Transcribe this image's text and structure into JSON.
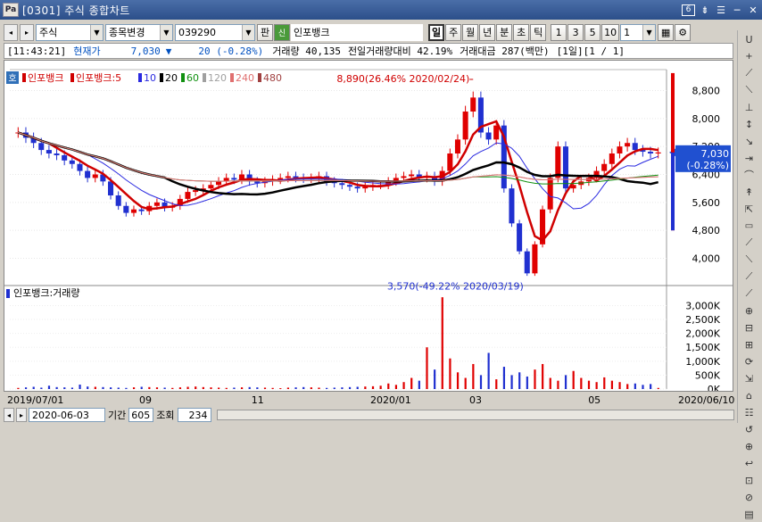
{
  "window": {
    "title": "[0301] 주식 종합차트",
    "badge_num": "6",
    "pin": "⇟",
    "menu": "☰",
    "minimize": "─",
    "close": "✕"
  },
  "toolbar": {
    "nav_prev": "◂",
    "nav_next": "▸",
    "market": "주식",
    "mode": "종목변경",
    "code": "039290",
    "search": "판",
    "stock_tag": "신",
    "stock_name": "인포뱅크",
    "periods": [
      "일",
      "주",
      "월",
      "년",
      "분",
      "초",
      "틱"
    ],
    "intervals": [
      "1",
      "3",
      "5",
      "10"
    ],
    "count": "1"
  },
  "info": {
    "time": "[11:43:21]",
    "label": "현재가",
    "price": "7,030",
    "direction": "▼",
    "change": "20 (-0.28%)",
    "volume": "거래량 40,135",
    "prev_volume": "전일거래량대비 42.19%",
    "amount": "거래대금 287(백만)",
    "page": "[1일][1 / 1]"
  },
  "chart_data": [
    {
      "type": "candlestick",
      "title_tag": "호",
      "legend": [
        "인포뱅크",
        "인포뱅크:5",
        "10",
        "20",
        "60",
        "120",
        "240",
        "480"
      ],
      "legend_colors": [
        "#d00000",
        "#d00000",
        "#2a2ae0",
        "#000000",
        "#109010",
        "#a0a0a0",
        "#e07070",
        "#a04040"
      ],
      "yticks": [
        "8,800",
        "8,000",
        "7,200",
        "6,400",
        "5,600",
        "4,800",
        "4,000"
      ],
      "ylim": [
        3400,
        9400
      ],
      "max_label": "8,890(26.46% 2020/02/24)",
      "min_label": "3,570(-49.22% 2020/03/19)",
      "current_price": "7,030",
      "current_change": "(-0.28%)",
      "close_series": [
        7600,
        7450,
        7300,
        7100,
        7000,
        6950,
        6800,
        6700,
        6500,
        6300,
        6400,
        6200,
        5800,
        5500,
        5300,
        5400,
        5350,
        5500,
        5600,
        5450,
        5500,
        5700,
        5900,
        5950,
        6000,
        6100,
        6200,
        6300,
        6250,
        6400,
        6200,
        6150,
        6200,
        6250,
        6300,
        6350,
        6300,
        6280,
        6300,
        6350,
        6200,
        6150,
        6100,
        6050,
        6000,
        6050,
        6100,
        6100,
        6200,
        6300,
        6350,
        6400,
        6300,
        6350,
        6200,
        6500,
        7000,
        7400,
        8200,
        8600,
        7600,
        7400,
        7800,
        6000,
        5000,
        4200,
        3570,
        4400,
        5400,
        6300,
        7200,
        6000,
        6100,
        6200,
        6300,
        6500,
        6700,
        7000,
        7200,
        7300,
        7100,
        7050,
        7000,
        7030
      ]
    },
    {
      "type": "bar",
      "title": "인포뱅크:거래량",
      "yticks": [
        "3,000K",
        "2,500K",
        "2,000K",
        "1,500K",
        "1,000K",
        "500K",
        "0K"
      ],
      "ylim": [
        0,
        3400
      ],
      "values": [
        40,
        60,
        80,
        50,
        120,
        70,
        60,
        50,
        160,
        90,
        80,
        70,
        60,
        50,
        40,
        60,
        80,
        70,
        60,
        50,
        40,
        60,
        80,
        90,
        70,
        60,
        50,
        40,
        50,
        60,
        70,
        60,
        50,
        40,
        30,
        50,
        60,
        70,
        60,
        50,
        40,
        50,
        60,
        70,
        80,
        90,
        100,
        120,
        200,
        150,
        250,
        400,
        300,
        1500,
        700,
        3300,
        1100,
        600,
        400,
        900,
        500,
        1300,
        350,
        800,
        500,
        600,
        450,
        700,
        900,
        400,
        300,
        500,
        650,
        400,
        300,
        250,
        420,
        300,
        250,
        180,
        200,
        150,
        180,
        40
      ],
      "xlabels": [
        "2019/07/01",
        "09",
        "11",
        "2020/01",
        "03",
        "05",
        "2020/06/10"
      ]
    }
  ],
  "bottom": {
    "date": "2020-06-03",
    "period_label": "기간",
    "period": "605",
    "query_label": "조회",
    "query": "234"
  },
  "sidebar": {
    "items": [
      "U",
      "+\nTOOL",
      "⟋",
      "⟍",
      "⊥",
      "↕",
      "↘",
      "⇥",
      "⌒",
      "↟",
      "⇱",
      "▭\nAUTO",
      "⟋",
      "⟍",
      "⟋",
      "⟋",
      "⊕",
      "⊟",
      "⊞",
      "⟳",
      "⇲",
      "⌂",
      "☷",
      "↺",
      "⊕",
      "↩",
      "⊡",
      "⊘",
      "▤"
    ]
  }
}
